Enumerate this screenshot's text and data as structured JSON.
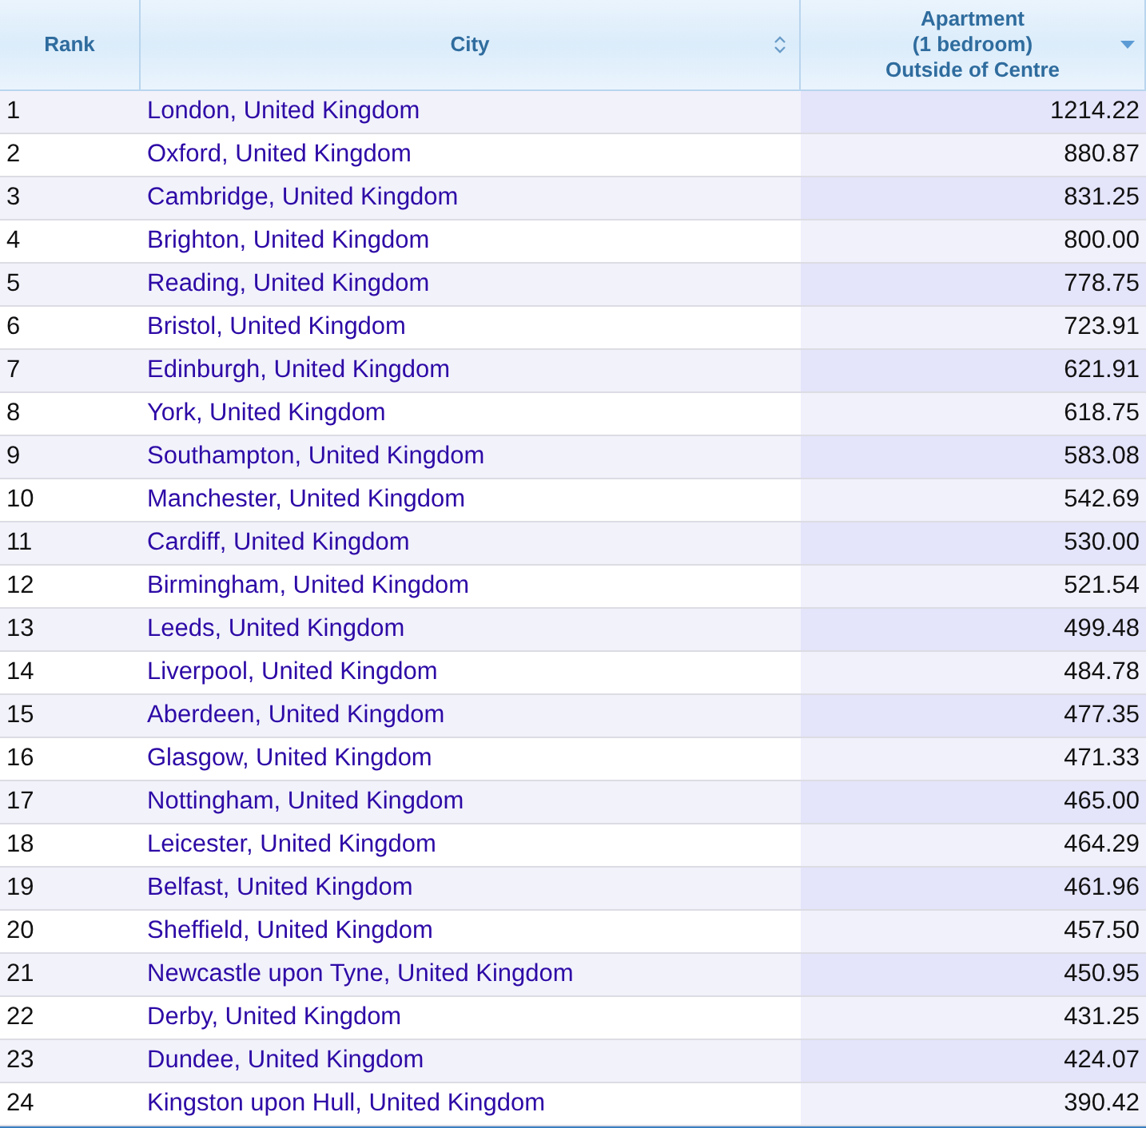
{
  "table": {
    "columns": [
      {
        "label": "Rank"
      },
      {
        "label": "City",
        "sortable": true,
        "sorted": false
      },
      {
        "label": "Apartment\n(1 bedroom)\nOutside of Centre",
        "sortable": true,
        "sorted": true
      }
    ],
    "rows": [
      {
        "rank": "1",
        "city": "London, United Kingdom",
        "value": "1214.22"
      },
      {
        "rank": "2",
        "city": "Oxford, United Kingdom",
        "value": "880.87"
      },
      {
        "rank": "3",
        "city": "Cambridge, United Kingdom",
        "value": "831.25"
      },
      {
        "rank": "4",
        "city": "Brighton, United Kingdom",
        "value": "800.00"
      },
      {
        "rank": "5",
        "city": "Reading, United Kingdom",
        "value": "778.75"
      },
      {
        "rank": "6",
        "city": "Bristol, United Kingdom",
        "value": "723.91"
      },
      {
        "rank": "7",
        "city": "Edinburgh, United Kingdom",
        "value": "621.91"
      },
      {
        "rank": "8",
        "city": "York, United Kingdom",
        "value": "618.75"
      },
      {
        "rank": "9",
        "city": "Southampton, United Kingdom",
        "value": "583.08"
      },
      {
        "rank": "10",
        "city": "Manchester, United Kingdom",
        "value": "542.69"
      },
      {
        "rank": "11",
        "city": "Cardiff, United Kingdom",
        "value": "530.00"
      },
      {
        "rank": "12",
        "city": "Birmingham, United Kingdom",
        "value": "521.54"
      },
      {
        "rank": "13",
        "city": "Leeds, United Kingdom",
        "value": "499.48"
      },
      {
        "rank": "14",
        "city": "Liverpool, United Kingdom",
        "value": "484.78"
      },
      {
        "rank": "15",
        "city": "Aberdeen, United Kingdom",
        "value": "477.35"
      },
      {
        "rank": "16",
        "city": "Glasgow, United Kingdom",
        "value": "471.33"
      },
      {
        "rank": "17",
        "city": "Nottingham, United Kingdom",
        "value": "465.00"
      },
      {
        "rank": "18",
        "city": "Leicester, United Kingdom",
        "value": "464.29"
      },
      {
        "rank": "19",
        "city": "Belfast, United Kingdom",
        "value": "461.96"
      },
      {
        "rank": "20",
        "city": "Sheffield, United Kingdom",
        "value": "457.50"
      },
      {
        "rank": "21",
        "city": "Newcastle upon Tyne, United Kingdom",
        "value": "450.95"
      },
      {
        "rank": "22",
        "city": "Derby, United Kingdom",
        "value": "431.25"
      },
      {
        "rank": "23",
        "city": "Dundee, United Kingdom",
        "value": "424.07"
      },
      {
        "rank": "24",
        "city": "Kingston upon Hull, United Kingdom",
        "value": "390.42"
      }
    ]
  }
}
